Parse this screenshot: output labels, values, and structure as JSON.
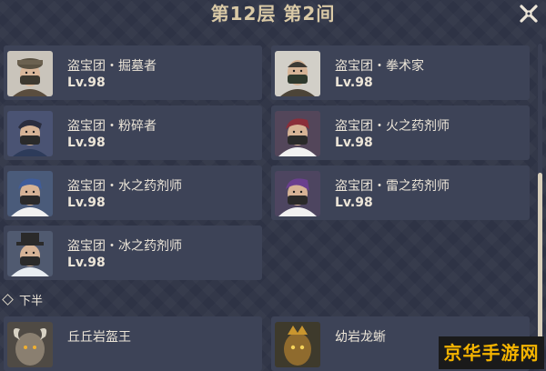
{
  "header": {
    "title": "第12层 第2间"
  },
  "enemies_top": [
    {
      "name": "盗宝团・掘墓者",
      "level": "Lv.98",
      "portrait": "masked-hat-man"
    },
    {
      "name": "盗宝团・拳术家",
      "level": "Lv.98",
      "portrait": "masked-bald-man"
    },
    {
      "name": "盗宝团・粉碎者",
      "level": "Lv.98",
      "portrait": "masked-man"
    },
    {
      "name": "盗宝团・火之药剂师",
      "level": "Lv.98",
      "portrait": "masked-red-hair"
    },
    {
      "name": "盗宝团・水之药剂师",
      "level": "Lv.98",
      "portrait": "masked-blue-hair"
    },
    {
      "name": "盗宝团・雷之药剂师",
      "level": "Lv.98",
      "portrait": "masked-purple-hair"
    },
    {
      "name": "盗宝团・冰之药剂师",
      "level": "Lv.98",
      "portrait": "masked-top-hat"
    }
  ],
  "second_half": {
    "label": "下半",
    "enemies": [
      {
        "name": "丘丘岩盔王",
        "portrait": "rock-helmet-king"
      },
      {
        "name": "幼岩龙蜥",
        "portrait": "rock-lizard"
      }
    ]
  },
  "watermark": "京华手游网",
  "colors": {
    "card_bg": "#3d4357",
    "title": "#d9c9a6",
    "text": "#ece5d8",
    "background": "#2e3345"
  }
}
